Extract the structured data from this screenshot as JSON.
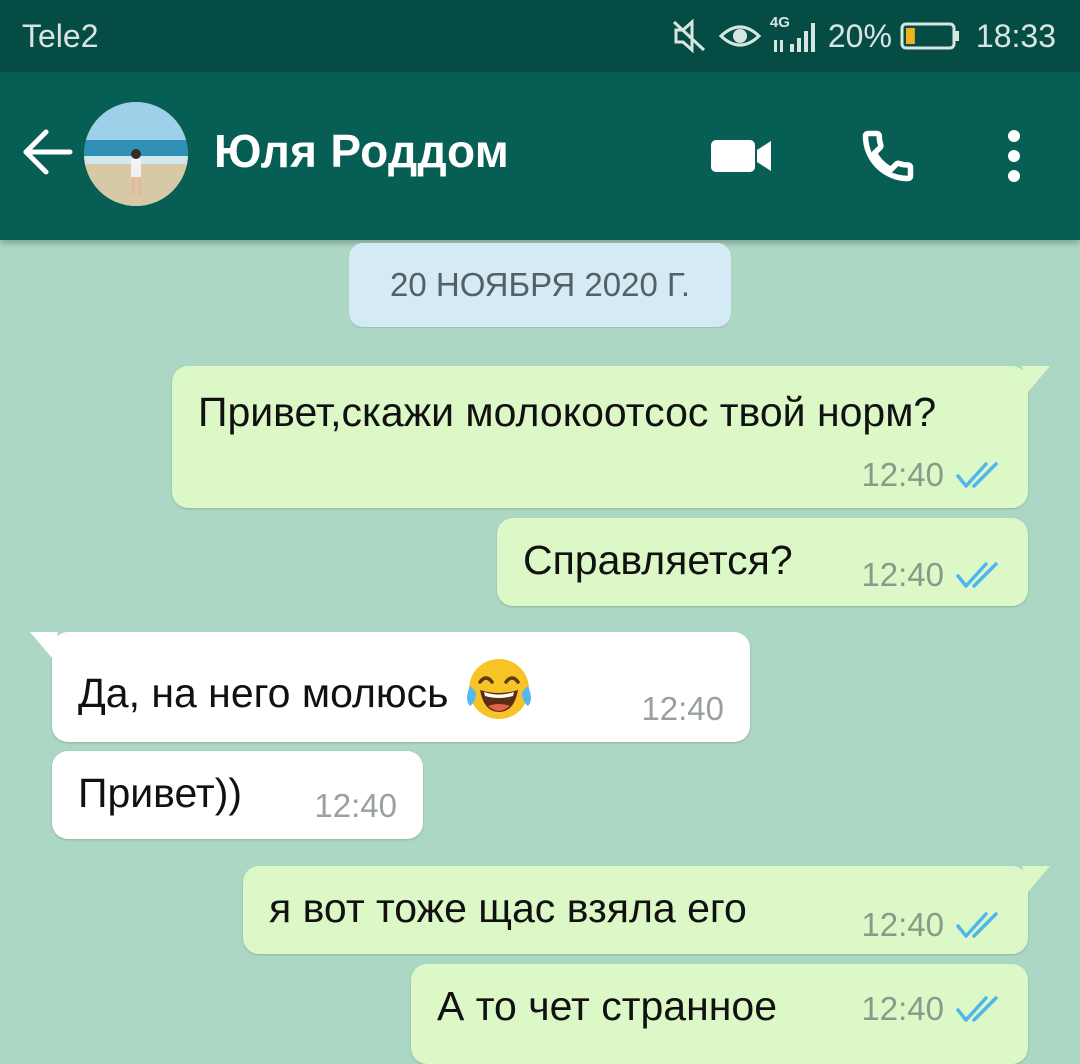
{
  "status_bar": {
    "carrier": "Tele2",
    "network": "4G",
    "battery_percent": "20%",
    "battery_level": 0.2,
    "time": "18:33",
    "icons": [
      "mute-icon",
      "eye-icon",
      "signal-icon",
      "battery-icon"
    ]
  },
  "header": {
    "contact_name": "Юля Роддом",
    "icons": [
      "back-arrow-icon",
      "video-call-icon",
      "phone-icon",
      "more-vert-icon"
    ]
  },
  "chat": {
    "date_chip": "20 НОЯБРЯ 2020 Г.",
    "messages": [
      {
        "direction": "out",
        "text": "Привет,скажи молокоотсос твой норм?",
        "time": "12:40",
        "status": "read"
      },
      {
        "direction": "out",
        "text": "Справляется?",
        "time": "12:40",
        "status": "read"
      },
      {
        "direction": "in",
        "text": "Да, на него молюсь",
        "emoji": "😂",
        "time": "12:40"
      },
      {
        "direction": "in",
        "text": "Привет))",
        "time": "12:40"
      },
      {
        "direction": "out",
        "text": "я вот тоже щас взяла его",
        "time": "12:40",
        "status": "read"
      },
      {
        "direction": "out",
        "text": "А то чет странное",
        "time": "12:40",
        "status": "read"
      }
    ]
  },
  "colors": {
    "status_bar": "#054d44",
    "app_bar": "#075e54",
    "chat_bg": "#acd7c5",
    "outgoing_bubble": "#dcf8c6",
    "incoming_bubble": "#ffffff",
    "read_tick": "#4fb6ec"
  }
}
